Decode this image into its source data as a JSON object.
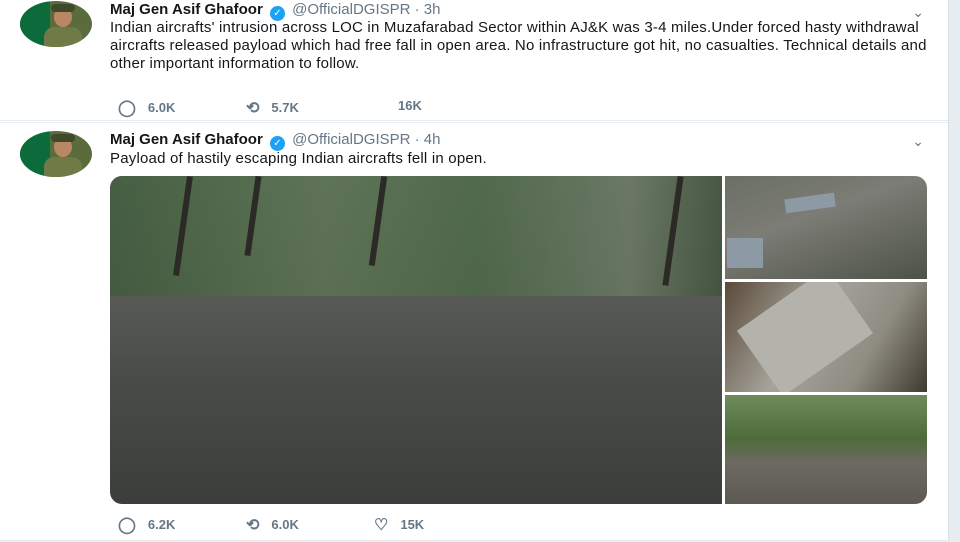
{
  "tweets": [
    {
      "name": "Maj Gen Asif Ghafoor",
      "handle": "@OfficialDGISPR",
      "time": "3h",
      "text": "Indian aircrafts' intrusion across LOC in Muzafarabad Sector within AJ&K was 3-4 miles.Under forced hasty withdrawal aircrafts released payload which had free fall in open area. No infrastructure got hit, no casualties. Technical details and other important information to follow.",
      "replies": "6.0K",
      "retweets": "5.7K",
      "likes": "16K"
    },
    {
      "name": "Maj Gen Asif Ghafoor",
      "handle": "@OfficialDGISPR",
      "time": "4h",
      "text": "Payload of hastily escaping Indian aircrafts fell in open.",
      "replies": "6.2K",
      "retweets": "6.0K",
      "likes": "15K"
    }
  ],
  "icons": {
    "verified": "verified-badge-icon",
    "reply": "reply-icon",
    "retweet": "retweet-icon",
    "like": "heart-icon",
    "caret": "chevron-down-icon"
  },
  "colors": {
    "accent": "#1da1f2",
    "muted": "#657786",
    "text": "#14171a"
  }
}
